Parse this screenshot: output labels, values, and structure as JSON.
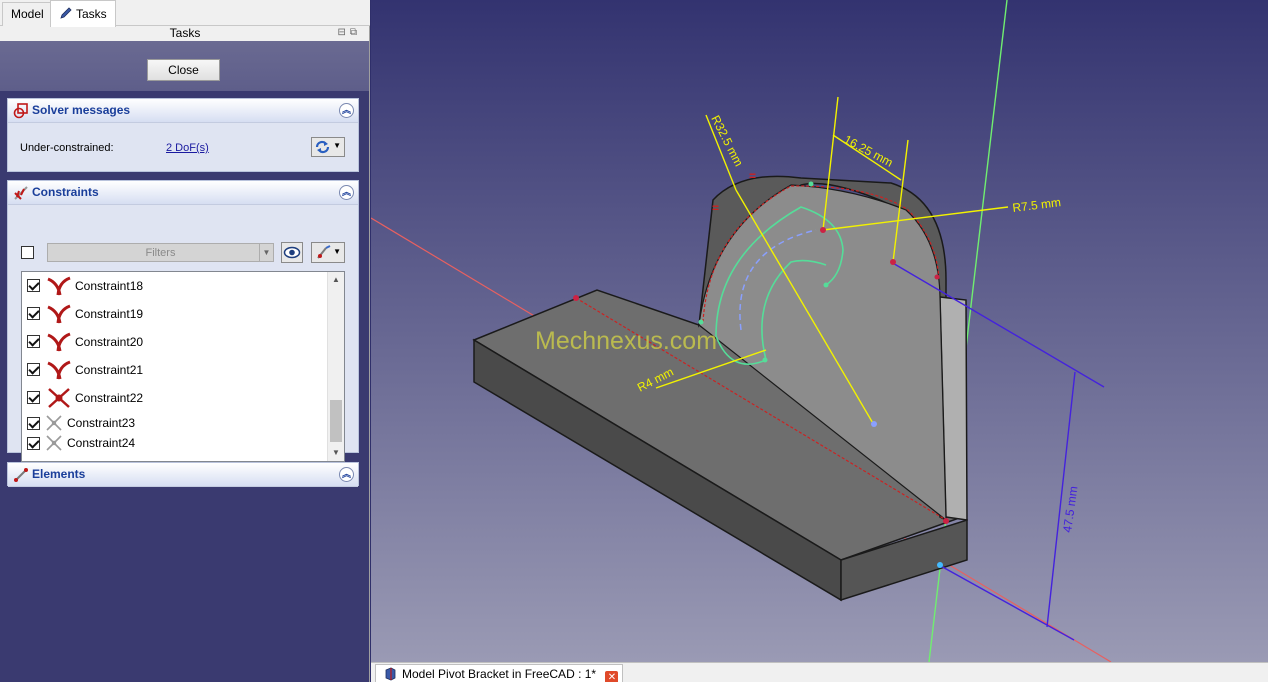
{
  "tabs": {
    "model": "Model",
    "tasks": "Tasks"
  },
  "tasks_title": "Tasks",
  "close_button": "Close",
  "solver": {
    "title": "Solver messages",
    "under_constrained_label": "Under-constrained:",
    "dof_link": "2 DoF(s)"
  },
  "constraints": {
    "title": "Constraints",
    "filters_placeholder": "Filters",
    "items": [
      {
        "label": "Constraint18",
        "icon": "tangent-icon"
      },
      {
        "label": "Constraint19",
        "icon": "tangent-icon"
      },
      {
        "label": "Constraint20",
        "icon": "tangent-icon"
      },
      {
        "label": "Constraint21",
        "icon": "tangent-icon"
      },
      {
        "label": "Constraint22",
        "icon": "symmetric-icon"
      },
      {
        "label": "Constraint23",
        "icon": "coincident-icon"
      },
      {
        "label": "Constraint24",
        "icon": "coincident-icon"
      }
    ]
  },
  "elements": {
    "title": "Elements"
  },
  "viewport": {
    "watermark": "Mechnexus.com",
    "dimensions": {
      "r32": "R32.5 mm",
      "d16": "16.25 mm",
      "r75": "R7.5 mm",
      "r4": "R4 mm",
      "d47": "47.5 mm",
      "eq1": "=",
      "eq2": "="
    }
  },
  "document_tab": {
    "label": "Model Pivot Bracket in FreeCAD : 1*"
  },
  "colors": {
    "panel_title": "#1a3e9a",
    "dimension_yellow": "#f2f200",
    "dimension_blue": "#4422dd",
    "axis_green": "#66ee66",
    "axis_red": "#ee5555",
    "sketch_green": "#55dd99"
  }
}
